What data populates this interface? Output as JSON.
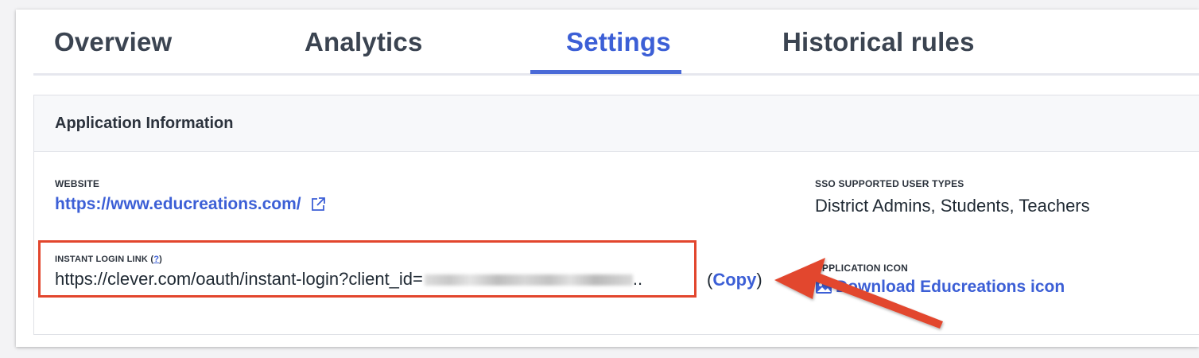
{
  "tabs": [
    {
      "label": "Overview",
      "active": false
    },
    {
      "label": "Analytics",
      "active": false
    },
    {
      "label": "Settings",
      "active": true
    },
    {
      "label": "Historical rules",
      "active": false
    }
  ],
  "panel": {
    "title": "Application Information",
    "website": {
      "label": "WEBSITE",
      "value": "https://www.educreations.com/"
    },
    "sso": {
      "label": "SSO SUPPORTED USER TYPES",
      "value": "District Admins, Students, Teachers"
    },
    "instant_login": {
      "label": "INSTANT LOGIN LINK",
      "help": "?",
      "value_prefix": "https://clever.com/oauth/instant-login?client_id=",
      "value_suffix": "..",
      "copy_open": "(",
      "copy_label": "Copy",
      "copy_close": ")"
    },
    "app_icon": {
      "label": "APPLICATION ICON",
      "download_label": "Download Educreations icon"
    }
  },
  "colors": {
    "accent": "#3c5fd6",
    "annotation": "#e2462d"
  }
}
